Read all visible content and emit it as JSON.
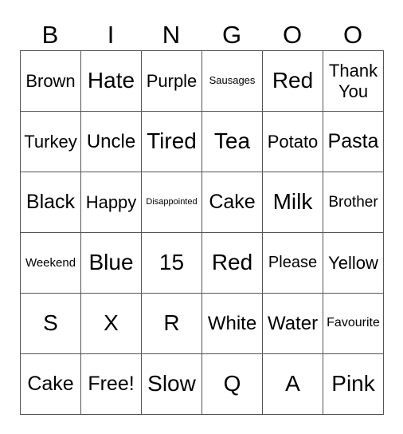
{
  "header": [
    "B",
    "I",
    "N",
    "G",
    "O",
    "O"
  ],
  "rows": [
    [
      "Brown",
      "Hate",
      "Purple",
      "Sausages",
      "Red",
      "Thank You"
    ],
    [
      "Turkey",
      "Uncle",
      "Tired",
      "Tea",
      "Potato",
      "Pasta"
    ],
    [
      "Black",
      "Happy",
      "Disappointed",
      "Cake",
      "Milk",
      "Brother"
    ],
    [
      "Weekend",
      "Blue",
      "15",
      "Red",
      "Please",
      "Yellow"
    ],
    [
      "S",
      "X",
      "R",
      "White",
      "Water",
      "Favourite"
    ],
    [
      "Cake",
      "Free!",
      "Slow",
      "Q",
      "A",
      "Pink"
    ]
  ]
}
